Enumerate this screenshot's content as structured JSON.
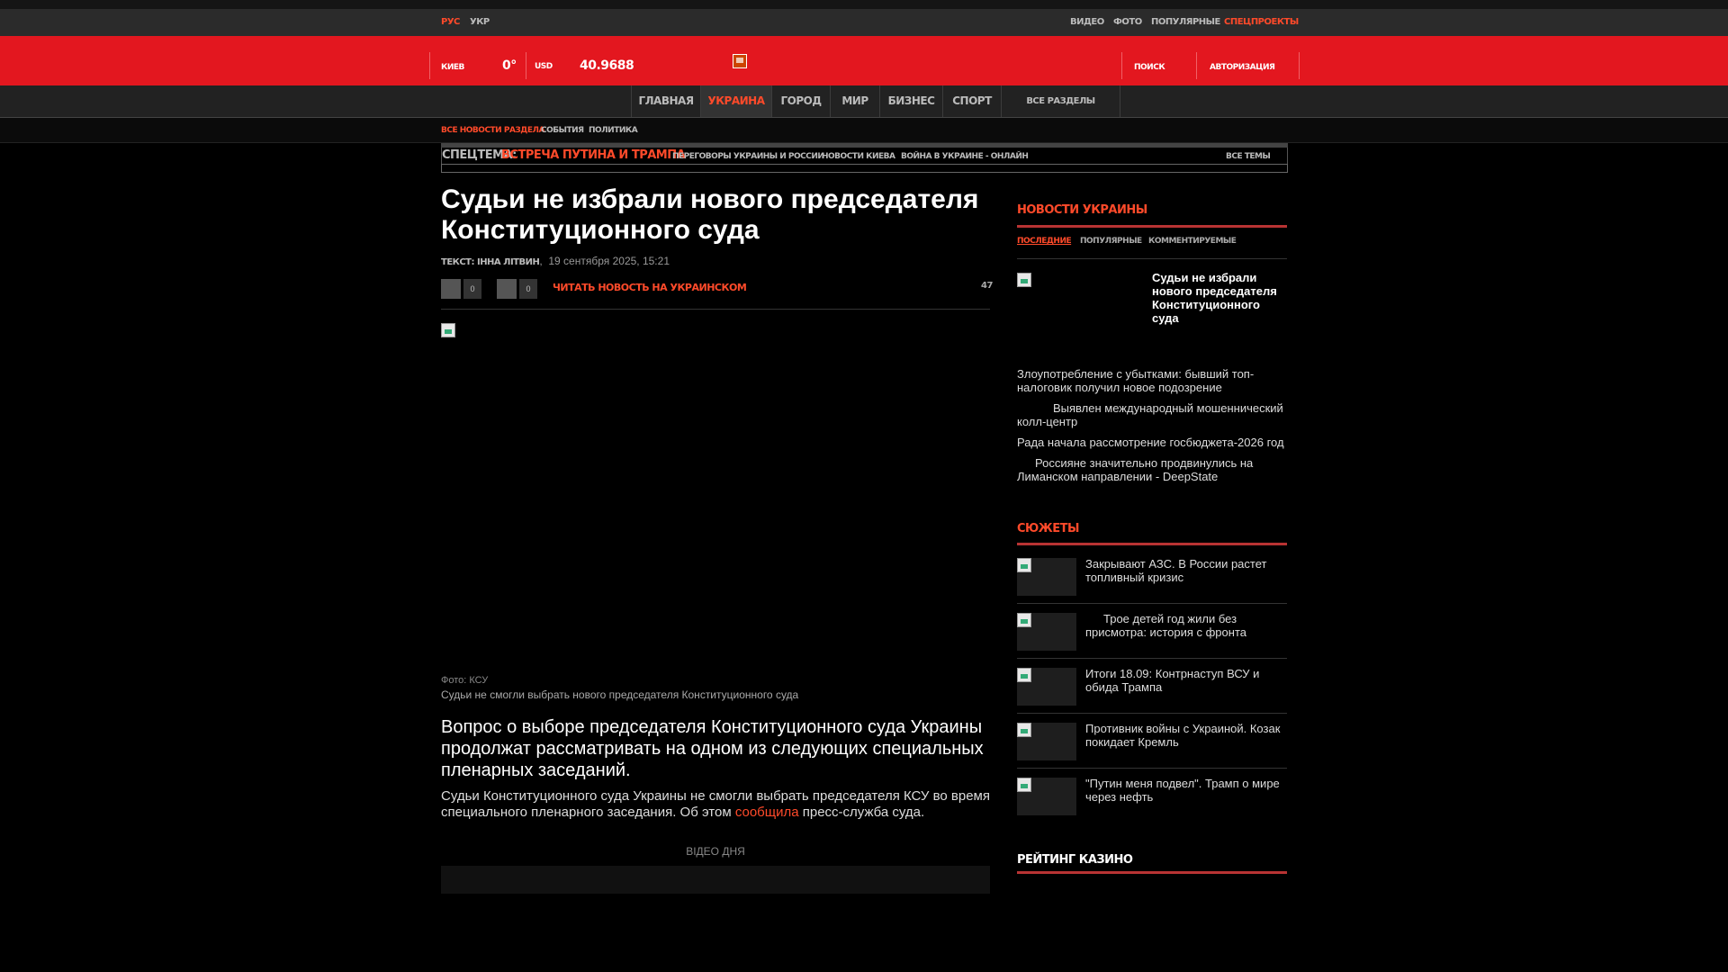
{
  "lang": {
    "ru": "РУС",
    "ua": "УКР"
  },
  "toplinks": [
    "ВИДЕО",
    "ФОТО",
    "ПОПУЛЯРНЫЕ",
    "СПЕЦПРОЕКТЫ"
  ],
  "header": {
    "city_label": "КИЕВ",
    "temperature": "0°",
    "currency_label": "USD",
    "currency_value": "40.9688",
    "search": "ПОИСК",
    "auth": "АВТОРИЗАЦИЯ"
  },
  "nav": {
    "items": [
      "ГЛАВНАЯ",
      "УКРАИНА",
      "ГОРОД",
      "МИР",
      "БИЗНЕС",
      "СПОРТ"
    ],
    "active": "УКРАИНА",
    "all_sections": "ВСЕ РАЗДЕЛЫ"
  },
  "subnav": [
    "ВСЕ НОВОСТИ РАЗДЕЛА",
    "СОБЫТИЯ",
    "ПОЛИТИКА"
  ],
  "spec": {
    "label": "СПЕЦТЕМА:",
    "highlight": "ВСТРЕЧА ПУТИНА И ТРАМПА",
    "links": [
      "ПЕРЕГОВОРЫ УКРАИНЫ И РОССИИ",
      "НОВОСТИ КИЕВА",
      "ВОЙНА В УКРАИНЕ - ОНЛАЙН"
    ],
    "all_topics": "ВСЕ ТЕМЫ"
  },
  "article": {
    "title": "Судьи не избрали нового председателя Конституционного суда",
    "author_prefix": "ТЕКСТ: ІННА ЛІТВИН",
    "date": "19 сентября 2025, 15:21",
    "like_count": "0",
    "dislike_count": "0",
    "read_ua": "ЧИТАТЬ НОВОСТЬ НА УКРАИНСКОМ",
    "views": "47",
    "photo_credit": "Фото: КСУ",
    "photo_caption": "Судьи не смогли выбрать нового председателя Конституционного суда",
    "lead": "Вопрос о выборе председателя Конституционного суда Украины продолжат рассматривать на одном из следующих специальных пленарных заседаний.",
    "body_before": "Судьи Конституционного суда Украины не смогли выбрать председателя КСУ во время специального пленарного заседания. Об этом ",
    "body_link": "сообщила",
    "body_after": " пресс-служба суда.",
    "video_day": "ВІДЕО ДНЯ"
  },
  "sidebar": {
    "news_heading": "НОВОСТИ УКРАИНЫ",
    "tabs": [
      "ПОСЛЕДНИЕ",
      "ПОПУЛЯРНЫЕ",
      "КОММЕНТИРУЕМЫЕ"
    ],
    "top_news": "Судьи не избрали нового председателя Конституционного суда",
    "news": [
      "Злоупотребление с убытками: бывший топ-налоговик получил новое подозрение",
      "Выявлен международный мошеннический колл-центр",
      "Рада начала рассмотрение госбюджета-2026 год",
      "Россияне значительно продвинулись на Лиманском направлении - DeepState"
    ],
    "stories_heading": "СЮЖЕТЫ",
    "stories": [
      "Закрывают АЗС. В России растет топливный кризис",
      "Трое детей год жили без присмотра: история с фронта",
      "Итоги 18.09: Контрнаступ ВСУ и обида Трампа",
      "Противник войны с Украиной. Козак покидает Кремль",
      "\"Путин меня подвел\". Трамп о мире через нефть"
    ],
    "casino_heading": "РЕЙТИНГ КАЗИНО"
  },
  "colors": {
    "brand_red": "#e3171f",
    "accent": "#ff4a2a"
  }
}
